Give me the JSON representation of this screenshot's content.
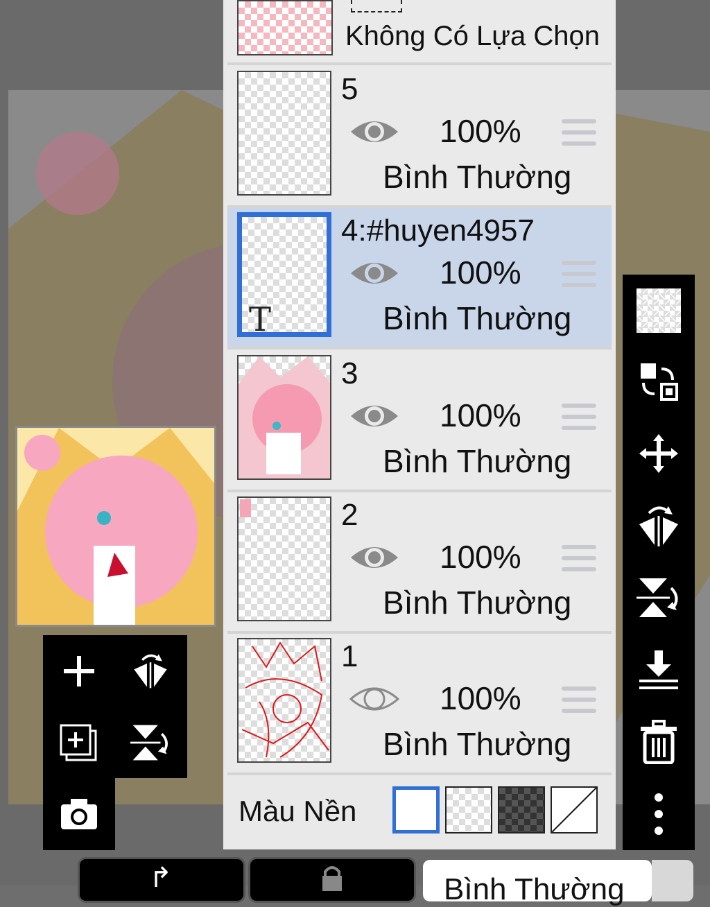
{
  "header_layer": {
    "label": "Không Có Lựa Chọn"
  },
  "layers": [
    {
      "name": "5",
      "opacity": "100%",
      "blend": "Bình Thường",
      "visible": true
    },
    {
      "name": "4:#huyen4957",
      "opacity": "100%",
      "blend": "Bình Thường",
      "visible": true,
      "selected": true,
      "thumb_text": "T"
    },
    {
      "name": "3",
      "opacity": "100%",
      "blend": "Bình Thường",
      "visible": true
    },
    {
      "name": "2",
      "opacity": "100%",
      "blend": "Bình Thường",
      "visible": true
    },
    {
      "name": "1",
      "opacity": "100%",
      "blend": "Bình Thường",
      "visible": false
    }
  ],
  "background": {
    "label": "Màu Nền",
    "selected": "white"
  },
  "bottom": {
    "blend_mode": "Bình Thường"
  },
  "colors": {
    "accent": "#2f6fd6",
    "selected_row": "#c9d6ea",
    "panel": "#e9e9e9"
  },
  "right_tools": [
    "transparency-icon",
    "swap-layer-icon",
    "move-icon",
    "flip-horizontal-icon",
    "flip-vertical-icon",
    "merge-down-icon",
    "trash-icon",
    "more-icon"
  ],
  "left_tools": [
    "add-layer-icon",
    "flip-horizontal-icon",
    "add-copy-layer-icon",
    "flip-vertical-icon",
    "camera-icon"
  ]
}
